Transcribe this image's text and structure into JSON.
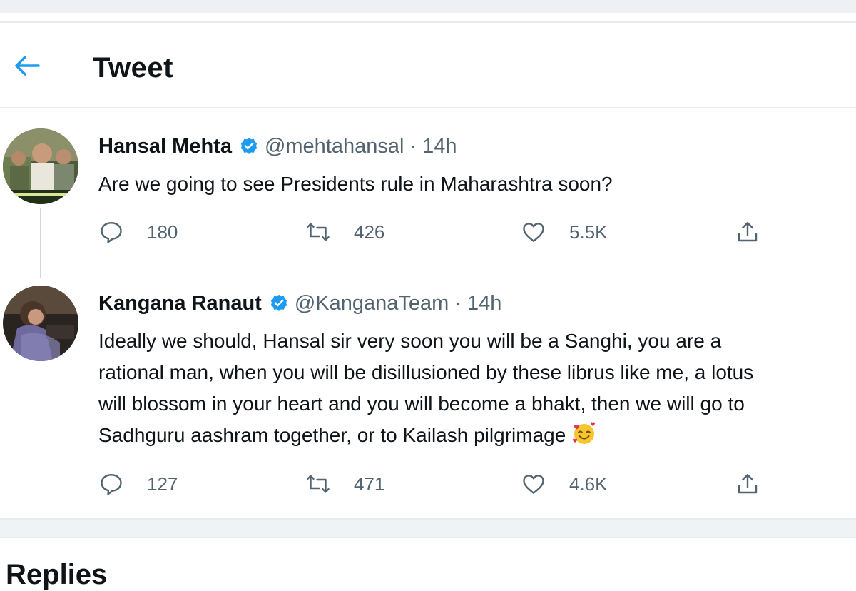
{
  "header": {
    "title": "Tweet",
    "back_icon": "arrow-left-icon",
    "accent": "#1d9bf0"
  },
  "tweets": [
    {
      "name": "Hansal Mehta",
      "handle": "@mehtahansal",
      "separator": "·",
      "time": "14h",
      "text_lines": [
        "Are we going to see Presidents rule in Maharashtra soon?"
      ],
      "replies": "180",
      "retweets": "426",
      "likes": "5.5K"
    },
    {
      "name": "Kangana Ranaut",
      "handle": "@KanganaTeam",
      "separator": "·",
      "time": "14h",
      "text_lines": [
        "Ideally we should, Hansal sir very soon you will be a Sanghi, you are a",
        "rational man, when you will be disillusioned by these librus like me, a lotus",
        "will blossom in your heart and you will become a bhakt, then we will go to",
        "Sadhguru aashram together, or to Kailash pilgrimage"
      ],
      "emoji": "smiling-face-with-hearts-emoji",
      "replies": "127",
      "retweets": "471",
      "likes": "4.6K"
    }
  ],
  "section": {
    "replies_label": "Replies"
  },
  "icons": {
    "reply": "speech-bubble-icon",
    "retweet": "retweet-icon",
    "like": "heart-icon",
    "share": "share-upload-icon",
    "verified": "verified-badge-icon"
  }
}
